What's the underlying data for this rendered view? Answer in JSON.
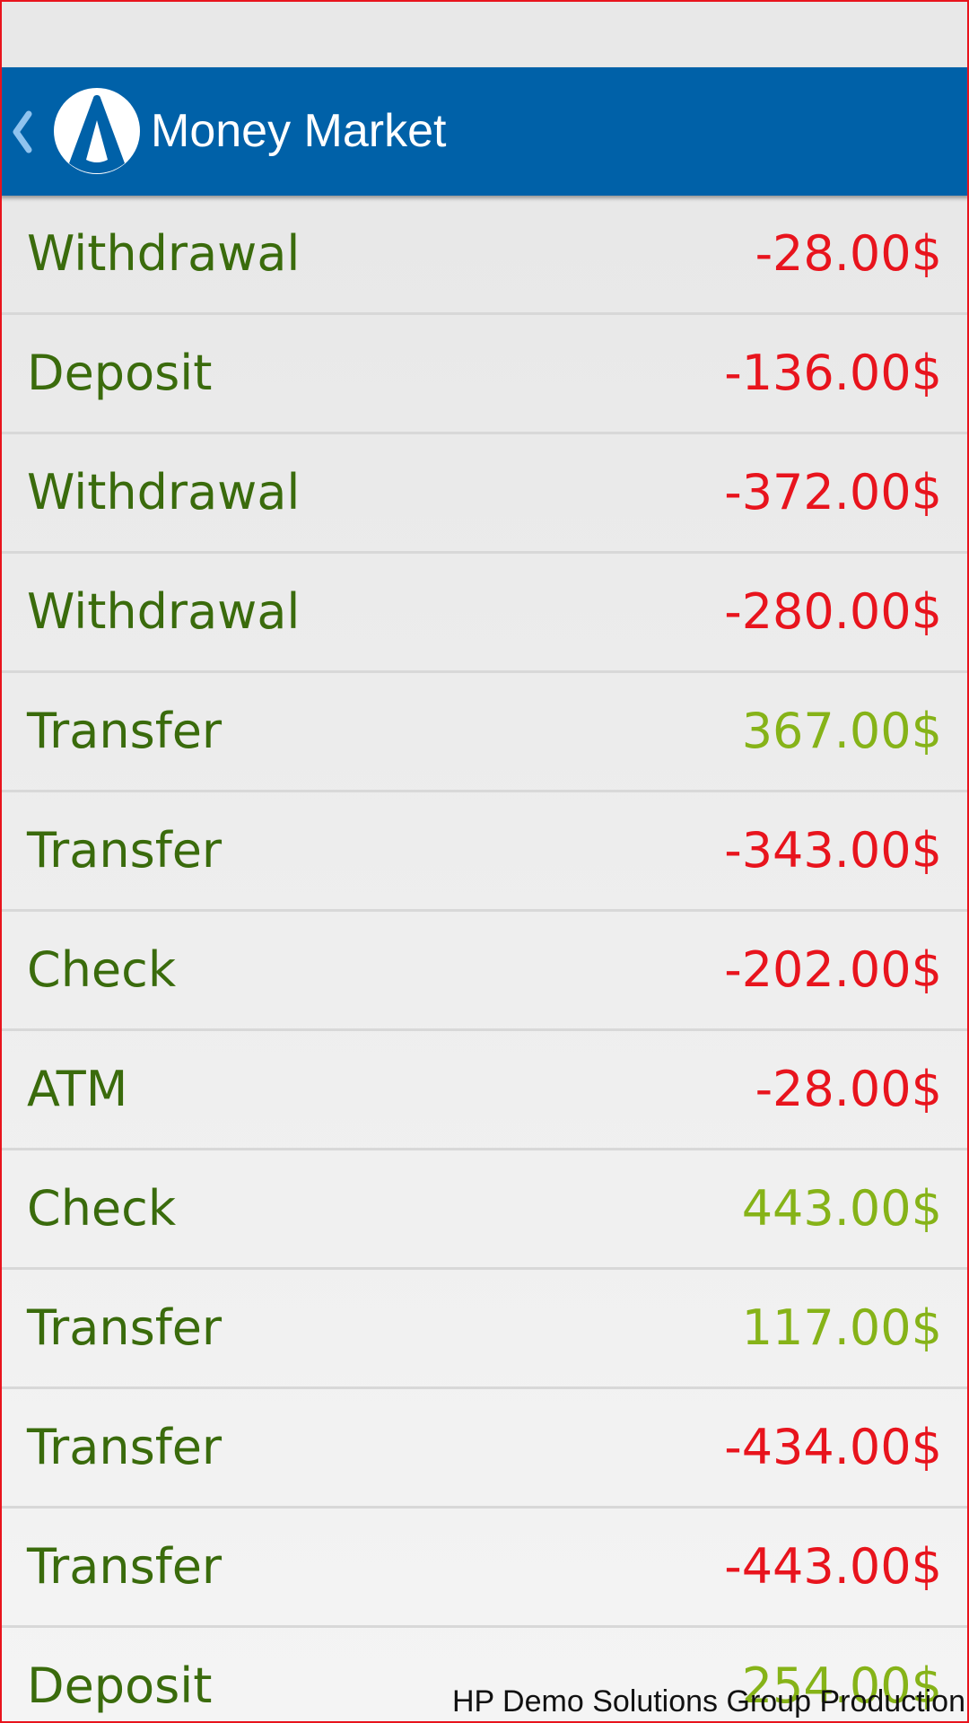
{
  "header": {
    "title": "Money Market",
    "back_icon": "chevron-left-icon",
    "logo_icon": "app-logo-icon"
  },
  "colors": {
    "action_bar": "#0061a8",
    "label": "#3a6b0c",
    "negative": "#e8141d",
    "positive": "#86b318",
    "frame": "#e8141d"
  },
  "transactions": [
    {
      "type": "Withdrawal",
      "amount": "-28.00$",
      "negative": true
    },
    {
      "type": "Deposit",
      "amount": "-136.00$",
      "negative": true
    },
    {
      "type": "Withdrawal",
      "amount": "-372.00$",
      "negative": true
    },
    {
      "type": "Withdrawal",
      "amount": "-280.00$",
      "negative": true
    },
    {
      "type": "Transfer",
      "amount": "367.00$",
      "negative": false
    },
    {
      "type": "Transfer",
      "amount": "-343.00$",
      "negative": true
    },
    {
      "type": "Check",
      "amount": "-202.00$",
      "negative": true
    },
    {
      "type": "ATM",
      "amount": "-28.00$",
      "negative": true
    },
    {
      "type": "Check",
      "amount": "443.00$",
      "negative": false
    },
    {
      "type": "Transfer",
      "amount": "117.00$",
      "negative": false
    },
    {
      "type": "Transfer",
      "amount": "-434.00$",
      "negative": true
    },
    {
      "type": "Transfer",
      "amount": "-443.00$",
      "negative": true
    },
    {
      "type": "Deposit",
      "amount": "254.00$",
      "negative": false
    }
  ],
  "footer": {
    "credit": "HP Demo Solutions Group Production"
  }
}
